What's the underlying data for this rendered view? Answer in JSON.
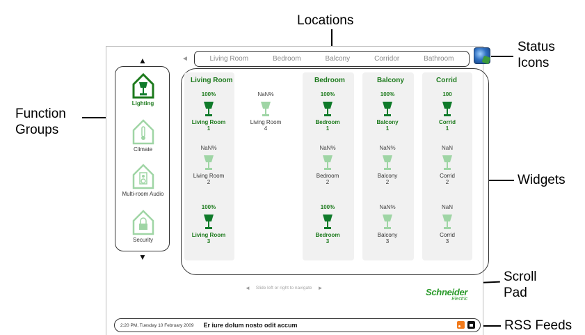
{
  "callouts": {
    "locations": "Locations",
    "status_icons_line1": "Status",
    "status_icons_line2": "Icons",
    "function_groups_line1": "Function",
    "function_groups_line2": "Groups",
    "widgets": "Widgets",
    "scroll_pad_line1": "Scroll",
    "scroll_pad_line2": "Pad",
    "rss_feeds": "RSS Feeds"
  },
  "locations": {
    "prev_arrow": "◄",
    "items": [
      "Living Room",
      "Bedroom",
      "Balcony",
      "Corridor",
      "Bathroom"
    ]
  },
  "status_icon": "globe-icon",
  "function_groups": {
    "up_arrow": "▲",
    "down_arrow": "▼",
    "items": [
      {
        "label": "Lighting",
        "icon": "lamp-house-icon",
        "active": true
      },
      {
        "label": "Climate",
        "icon": "thermometer-house-icon",
        "active": false
      },
      {
        "label": "Multi-room Audio",
        "icon": "speaker-house-icon",
        "active": false
      },
      {
        "label": "Security",
        "icon": "lock-house-icon",
        "active": false
      }
    ]
  },
  "widgets": {
    "columns": [
      {
        "title": "Living Room",
        "widgets": [
          {
            "pct": "100%",
            "name1": "Living Room",
            "name2": "1",
            "on": true
          },
          {
            "pct": "NaN%",
            "name1": "Living Room",
            "name2": "2",
            "on": false
          },
          {
            "pct": "100%",
            "name1": "Living Room",
            "name2": "3",
            "on": true
          },
          {
            "pct": "NaN%",
            "name1": "Living Room",
            "name2": "4",
            "on": false
          }
        ]
      },
      {
        "title": "Bedroom",
        "widgets": [
          {
            "pct": "100%",
            "name1": "Bedroom",
            "name2": "1",
            "on": true
          },
          {
            "pct": "NaN%",
            "name1": "Bedroom",
            "name2": "2",
            "on": false
          },
          {
            "pct": "100%",
            "name1": "Bedroom",
            "name2": "3",
            "on": true
          }
        ]
      },
      {
        "title": "Balcony",
        "widgets": [
          {
            "pct": "100%",
            "name1": "Balcony",
            "name2": "1",
            "on": true
          },
          {
            "pct": "NaN%",
            "name1": "Balcony",
            "name2": "2",
            "on": false
          },
          {
            "pct": "NaN%",
            "name1": "Balcony",
            "name2": "3",
            "on": false
          }
        ]
      },
      {
        "title": "Corrid",
        "widgets": [
          {
            "pct": "100",
            "name1": "Corrid",
            "name2": "1",
            "on": true
          },
          {
            "pct": "NaN",
            "name1": "Corrid",
            "name2": "2",
            "on": false
          },
          {
            "pct": "NaN",
            "name1": "Corrid",
            "name2": "3",
            "on": false
          }
        ]
      }
    ]
  },
  "scroll_pad": {
    "left_arrow": "◄",
    "hint": "Slide left or right to navigate",
    "right_arrow": "►"
  },
  "logo": {
    "main": "Schneider",
    "sub": "Electric"
  },
  "footer": {
    "datetime": "2:20 PM, Tuesday 10 February 2009",
    "news": "Er iure dolum nosto odit accum",
    "rss_icon": "rss-icon",
    "lock_icon": "lock-icon"
  },
  "colors": {
    "accent_green": "#1c7a1c",
    "lamp_on": "#0f7a2a",
    "lamp_off": "#9fd5a5"
  }
}
